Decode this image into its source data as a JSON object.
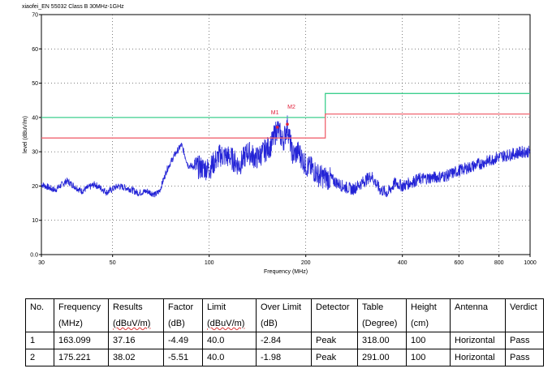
{
  "chart_data": {
    "type": "line",
    "title": "xiaofei_EN 55032 Class B 30MHz-1GHz",
    "xlabel": "Frequency (MHz)",
    "ylabel": "level (dBuV/m)",
    "xscale": "log",
    "xlim": [
      30,
      1000
    ],
    "ylim": [
      0,
      70
    ],
    "xticks": [
      30,
      50,
      100,
      200,
      400,
      600,
      800,
      1000
    ],
    "yticks": [
      0,
      10,
      20,
      30,
      40,
      50,
      60,
      70
    ],
    "ytick_labels": [
      "0.0",
      "10",
      "20",
      "30",
      "40",
      "50",
      "60",
      "70"
    ],
    "grid": true,
    "series": [
      {
        "color": "#2323d6",
        "points": [
          [
            30,
            20.5
          ],
          [
            33,
            18.8
          ],
          [
            36,
            21.5
          ],
          [
            40,
            18.5
          ],
          [
            44,
            20.5
          ],
          [
            48,
            18.2
          ],
          [
            52,
            20
          ],
          [
            56,
            19.3
          ],
          [
            60,
            18
          ],
          [
            64,
            18.5
          ],
          [
            68,
            17.5
          ],
          [
            70,
            18.5
          ],
          [
            74,
            25
          ],
          [
            78,
            29
          ],
          [
            82,
            32
          ],
          [
            86,
            26
          ],
          [
            92,
            25.5
          ],
          [
            100,
            25
          ],
          [
            108,
            29
          ],
          [
            116,
            28.5
          ],
          [
            124,
            26
          ],
          [
            132,
            30
          ],
          [
            140,
            28
          ],
          [
            148,
            30
          ],
          [
            156,
            32
          ],
          [
            163.1,
            37
          ],
          [
            170,
            33
          ],
          [
            175.2,
            37.5
          ],
          [
            182,
            29
          ],
          [
            190,
            30
          ],
          [
            200,
            26
          ],
          [
            210,
            25
          ],
          [
            220,
            23
          ],
          [
            240,
            22
          ],
          [
            260,
            20
          ],
          [
            280,
            19
          ],
          [
            300,
            21
          ],
          [
            320,
            23
          ],
          [
            340,
            19
          ],
          [
            360,
            18
          ],
          [
            380,
            21
          ],
          [
            400,
            20
          ],
          [
            450,
            22
          ],
          [
            500,
            22.5
          ],
          [
            550,
            23
          ],
          [
            600,
            24.5
          ],
          [
            650,
            25.5
          ],
          [
            700,
            26.5
          ],
          [
            750,
            27.5
          ],
          [
            800,
            28.5
          ],
          [
            850,
            29
          ],
          [
            900,
            29.5
          ],
          [
            950,
            30
          ],
          [
            1000,
            30
          ]
        ]
      },
      {
        "color": "#3ecf8e",
        "points": [
          [
            30,
            40
          ],
          [
            230,
            40
          ],
          [
            230,
            47
          ],
          [
            1000,
            47
          ]
        ]
      },
      {
        "color": "#f06470",
        "points": [
          [
            30,
            34
          ],
          [
            230,
            34
          ],
          [
            230,
            41
          ],
          [
            1000,
            41
          ]
        ]
      }
    ],
    "markers": [
      {
        "label": "M1",
        "x": 163.099,
        "y": 37.16
      },
      {
        "label": "M2",
        "x": 175.221,
        "y": 38.02
      }
    ]
  },
  "table": {
    "headers": [
      {
        "line1": "No.",
        "line2": ""
      },
      {
        "line1": "Frequency",
        "line2": "(MHz)"
      },
      {
        "line1": "Results",
        "line2": "(dBuV/m)"
      },
      {
        "line1": "Factor",
        "line2": "(dB)"
      },
      {
        "line1": "Limit",
        "line2": "(dBuV/m)"
      },
      {
        "line1": "Over Limit",
        "line2": "(dB)"
      },
      {
        "line1": "Detector",
        "line2": ""
      },
      {
        "line1": "Table",
        "line2": "(Degree)"
      },
      {
        "line1": "Height",
        "line2": "(cm)"
      },
      {
        "line1": "Antenna",
        "line2": ""
      },
      {
        "line1": "Verdict",
        "line2": ""
      }
    ],
    "rows": [
      [
        "1",
        "163.099",
        "37.16",
        "-4.49",
        "40.0",
        "-2.84",
        "Peak",
        "318.00",
        "100",
        "Horizontal",
        "Pass"
      ],
      [
        "2",
        "175.221",
        "38.02",
        "-5.51",
        "40.0",
        "-1.98",
        "Peak",
        "291.00",
        "100",
        "Horizontal",
        "Pass"
      ]
    ]
  }
}
